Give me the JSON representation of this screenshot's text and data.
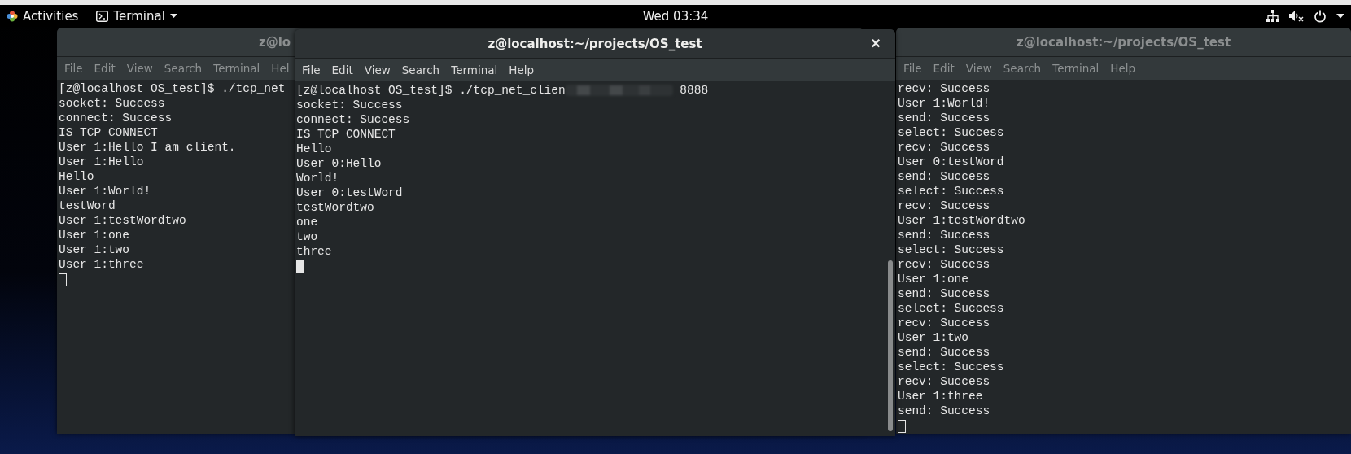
{
  "top_bar": {
    "activities": "Activities",
    "app_menu": "Terminal",
    "clock": "Wed 03:34"
  },
  "windows": [
    {
      "title": "z@lo",
      "focused": false,
      "menu": [
        "File",
        "Edit",
        "View",
        "Search",
        "Terminal",
        "Hel"
      ],
      "lines": [
        "[z@localhost OS_test]$ ./tcp_net",
        "socket: Success",
        "connect: Success",
        "IS TCP CONNECT",
        "User 1:Hello I am client.",
        "User 1:Hello",
        "Hello",
        "User 1:World!",
        "testWord",
        "User 1:testWordtwo",
        "User 1:one",
        "User 1:two",
        "User 1:three"
      ]
    },
    {
      "title": "z@localhost:~/projects/OS_test",
      "focused": true,
      "close": "×",
      "menu": [
        "File",
        "Edit",
        "View",
        "Search",
        "Terminal",
        "Help"
      ],
      "prompt": {
        "before": "[z@localhost OS_test]$ ./tcp_net_clien",
        "after": "8888"
      },
      "lines": [
        "socket: Success",
        "connect: Success",
        "IS TCP CONNECT",
        "Hello",
        "User 0:Hello",
        "World!",
        "User 0:testWord",
        "testWordtwo",
        "one",
        "two",
        "three"
      ]
    },
    {
      "title": "z@localhost:~/projects/OS_test",
      "focused": false,
      "menu": [
        "File",
        "Edit",
        "View",
        "Search",
        "Terminal",
        "Help"
      ],
      "lines": [
        "recv: Success",
        "User 1:World!",
        "send: Success",
        "select: Success",
        "recv: Success",
        "User 0:testWord",
        "send: Success",
        "select: Success",
        "recv: Success",
        "User 1:testWordtwo",
        "send: Success",
        "select: Success",
        "recv: Success",
        "User 1:one",
        "send: Success",
        "select: Success",
        "recv: Success",
        "User 1:two",
        "send: Success",
        "select: Success",
        "recv: Success",
        "User 1:three",
        "send: Success"
      ]
    }
  ]
}
